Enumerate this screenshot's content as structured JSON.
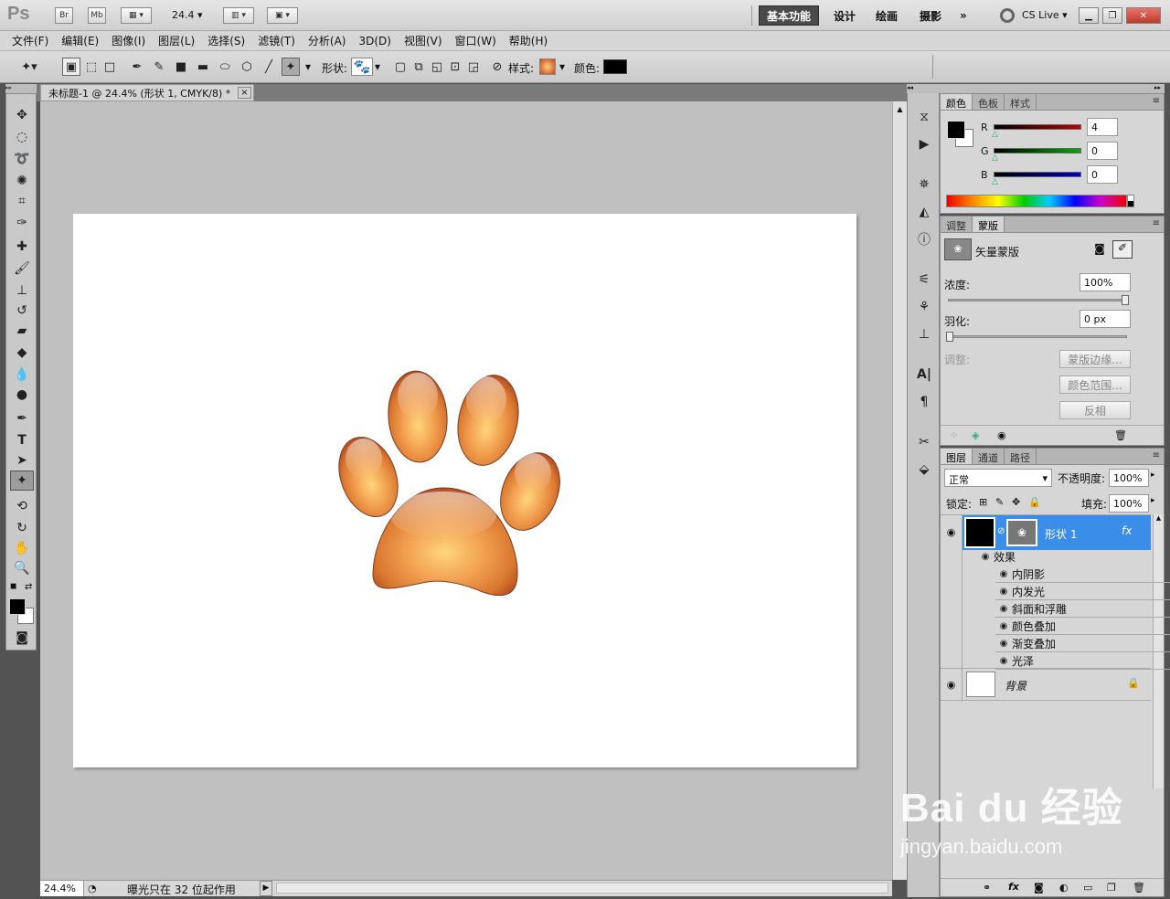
{
  "appbar": {
    "logo": "Ps",
    "br": "Br",
    "mb": "Mb",
    "zoom": "24.4",
    "workspaces": [
      "基本功能",
      "设计",
      "绘画",
      "摄影"
    ],
    "more": "»",
    "cslive": "CS Live"
  },
  "menu": [
    "文件(F)",
    "编辑(E)",
    "图像(I)",
    "图层(L)",
    "选择(S)",
    "滤镜(T)",
    "分析(A)",
    "3D(D)",
    "视图(V)",
    "窗口(W)",
    "帮助(H)"
  ],
  "options": {
    "shape_label": "形状:",
    "style_label": "样式:",
    "color_label": "颜色:",
    "color": "#000000"
  },
  "document": {
    "tab_title": "未标题-1 @ 24.4% (形状 1, CMYK/8) *",
    "close": "×",
    "zoom": "24.4%",
    "status": "曝光只在 32 位起作用"
  },
  "color_panel": {
    "tabs": [
      "颜色",
      "色板",
      "样式"
    ],
    "channels": [
      {
        "label": "R",
        "value": "4",
        "color": "#c00000"
      },
      {
        "label": "G",
        "value": "0",
        "color": "#00b000"
      },
      {
        "label": "B",
        "value": "0",
        "color": "#0000c8"
      }
    ]
  },
  "mask_panel": {
    "tabs": [
      "调整",
      "蒙版"
    ],
    "title": "矢量蒙版",
    "density_label": "浓度:",
    "density": "100%",
    "feather_label": "羽化:",
    "feather": "0 px",
    "adjust_label": "调整:",
    "buttons": [
      "蒙版边缘...",
      "颜色范围...",
      "反相"
    ]
  },
  "layers_panel": {
    "tabs": [
      "图层",
      "通道",
      "路径"
    ],
    "blend": "正常",
    "opacity_label": "不透明度:",
    "opacity": "100%",
    "lock_label": "锁定:",
    "fill_label": "填充:",
    "fill": "100%",
    "layers": [
      {
        "name": "形状 1",
        "selected": true,
        "fx": "fx"
      },
      {
        "name": "背景",
        "selected": false
      }
    ],
    "effects_label": "效果",
    "effects": [
      "内阴影",
      "内发光",
      "斜面和浮雕",
      "颜色叠加",
      "渐变叠加",
      "光泽"
    ]
  },
  "watermark": {
    "brand": "Bai du 经验",
    "url": "jingyan.baidu.com"
  }
}
